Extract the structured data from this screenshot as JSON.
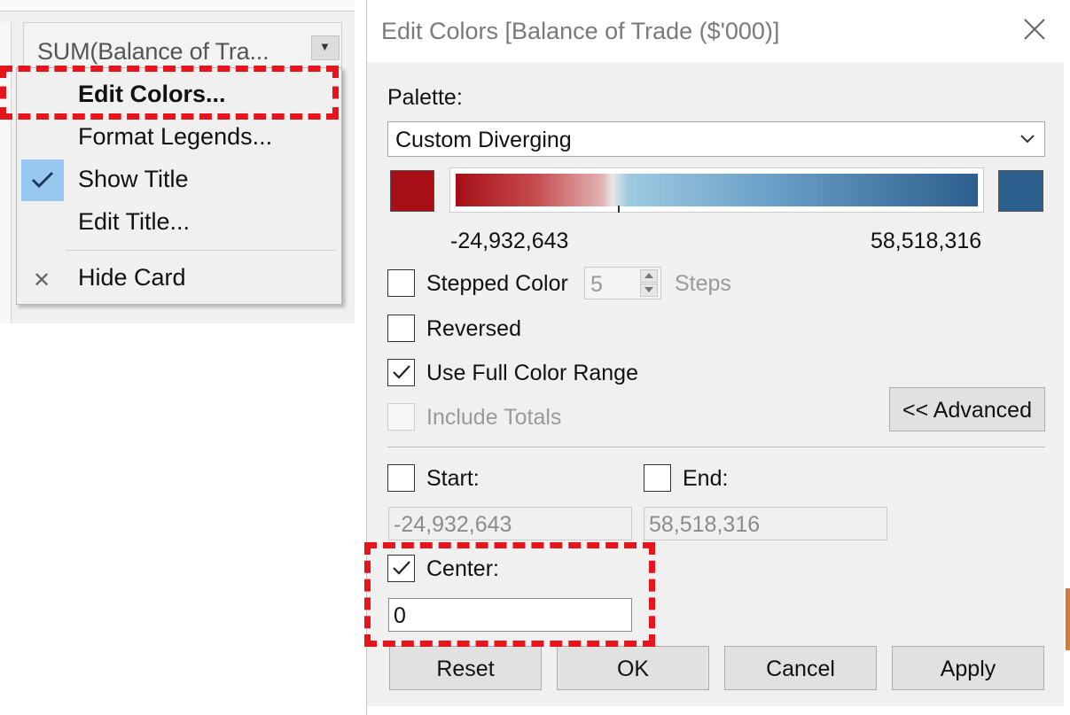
{
  "legend_card": {
    "title": "SUM(Balance of Tra...",
    "dropdown_icon": "triangle-down-icon"
  },
  "context_menu": {
    "items": [
      {
        "label": "Edit Colors...",
        "bold": true
      },
      {
        "label": "Format Legends..."
      },
      {
        "label": "Show Title",
        "checked": true
      },
      {
        "label": "Edit Title..."
      },
      {
        "label": "Hide Card",
        "icon": "close-icon"
      }
    ]
  },
  "dialog": {
    "title": "Edit Colors [Balance of Trade ($'000)]",
    "palette_label": "Palette:",
    "palette_value": "Custom Diverging",
    "start_color": "#a50f15",
    "end_color": "#2d5f8e",
    "range_min": "-24,932,643",
    "range_max": "58,518,316",
    "stepped_color": {
      "label": "Stepped Color",
      "checked": false,
      "steps_value": "5",
      "steps_label": "Steps"
    },
    "reversed": {
      "label": "Reversed",
      "checked": false
    },
    "use_full_color_range": {
      "label": "Use Full Color Range",
      "checked": true
    },
    "include_totals": {
      "label": "Include Totals",
      "checked": false,
      "disabled": true
    },
    "advanced_button": "<< Advanced",
    "start": {
      "label": "Start:",
      "checked": false,
      "value": "-24,932,643"
    },
    "end": {
      "label": "End:",
      "checked": false,
      "value": "58,518,316"
    },
    "center": {
      "label": "Center:",
      "checked": true,
      "value": "0"
    },
    "buttons": {
      "reset": "Reset",
      "ok": "OK",
      "cancel": "Cancel",
      "apply": "Apply"
    }
  },
  "colors": {
    "highlight": "#e8141b",
    "menu_check_bg": "#98c8ef"
  }
}
